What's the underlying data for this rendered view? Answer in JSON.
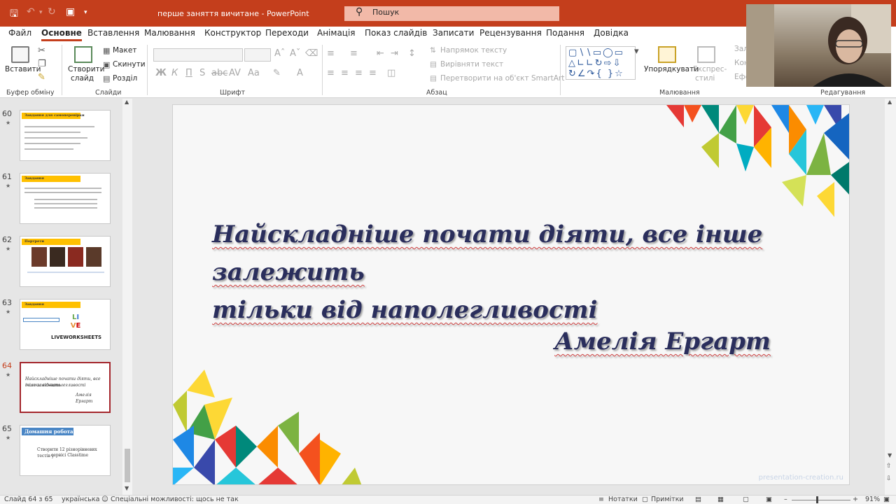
{
  "titlebar": {
    "document_title": "перше заняття вичитане  -  PowerPoint",
    "search_placeholder": "Пошук"
  },
  "menu": {
    "tabs": [
      "Файл",
      "Основне",
      "Вставлення",
      "Малювання",
      "Конструктор",
      "Переходи",
      "Анімація",
      "Показ слайдів",
      "Записати",
      "Рецензування",
      "Подання",
      "Довідка"
    ]
  },
  "ribbon": {
    "clipboard": {
      "paste": "Вставити",
      "group": "Буфер обміну"
    },
    "slides": {
      "new_slide_1": "Створити",
      "new_slide_2": "слайд",
      "layout": "Макет",
      "reset": "Скинути",
      "section": "Розділ",
      "group": "Слайди"
    },
    "font": {
      "group": "Шрифт"
    },
    "paragraph": {
      "text_direction": "Напрямок тексту",
      "align_text": "Вирівняти текст",
      "smartart": "Перетворити на об'єкт SmartArt",
      "group": "Абзац"
    },
    "drawing": {
      "arrange": "Упорядкувати",
      "quick_styles_1": "Експрес-",
      "quick_styles_2": "стилі",
      "group": "Малювання"
    },
    "editing": {
      "group": "Редагування",
      "find": "Зал",
      "replace": "Кон",
      "select": "Ефе"
    }
  },
  "thumbnails": [
    {
      "num": "60",
      "title": "Завдання для самоперевірки"
    },
    {
      "num": "61",
      "title": "Завдання"
    },
    {
      "num": "62",
      "title": "Портрети"
    },
    {
      "num": "63",
      "title": "Завдання",
      "label": "LIVEWORKSHEETS"
    },
    {
      "num": "64",
      "text1": "Найскладніше почати діяти, все інше залежить",
      "text2": "тільки від наполегливості",
      "author": "Амелія Ергарт"
    },
    {
      "num": "65",
      "title": "Домашня робота",
      "text1": "Створити 12 різнорівневих тестів у",
      "text2": "сервісі Classtime"
    }
  ],
  "slide": {
    "quote_line1": "Найскладніше почати діяти, все інше залежить",
    "quote_line2": "тільки від наполегливості",
    "author": "Амелія Ергарт",
    "watermark": "presentation-creation.ru"
  },
  "statusbar": {
    "slide_info": "Слайд 64 з 65",
    "language": "українська",
    "accessibility": "Спеціальні можливості: щось не так",
    "notes": "Нотатки",
    "comments": "Примітки",
    "zoom": "91%"
  },
  "colors": {
    "brand": "#c43e1c",
    "slide_text": "#2a2e5c"
  }
}
